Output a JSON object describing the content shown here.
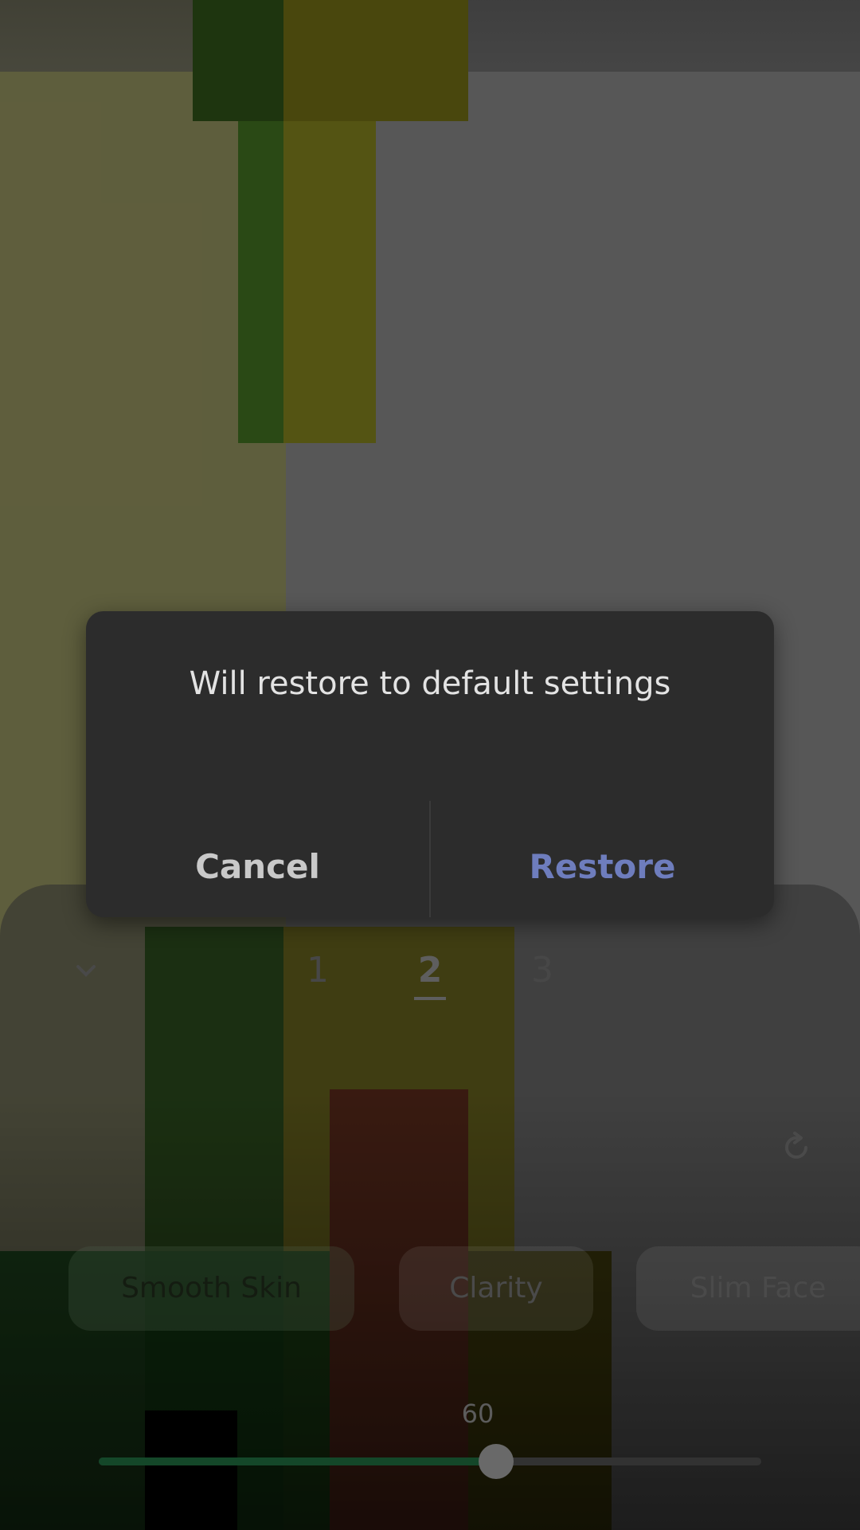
{
  "dialog": {
    "message": "Will restore to default settings",
    "cancel_label": "Cancel",
    "restore_label": "Restore",
    "restore_color": "#6e7dbd"
  },
  "panel": {
    "collapse_icon": "chevron-down-icon",
    "tabs": [
      "1",
      "2",
      "3"
    ],
    "active_tab": "2",
    "reset_icon": "refresh-icon",
    "chips": [
      "Smooth Skin",
      "Clarity",
      "Slim Face"
    ],
    "selected_chip": "Smooth Skin",
    "slider_value": 60,
    "slider_fraction": 0.6,
    "accent_color": "#1f6a3e"
  }
}
